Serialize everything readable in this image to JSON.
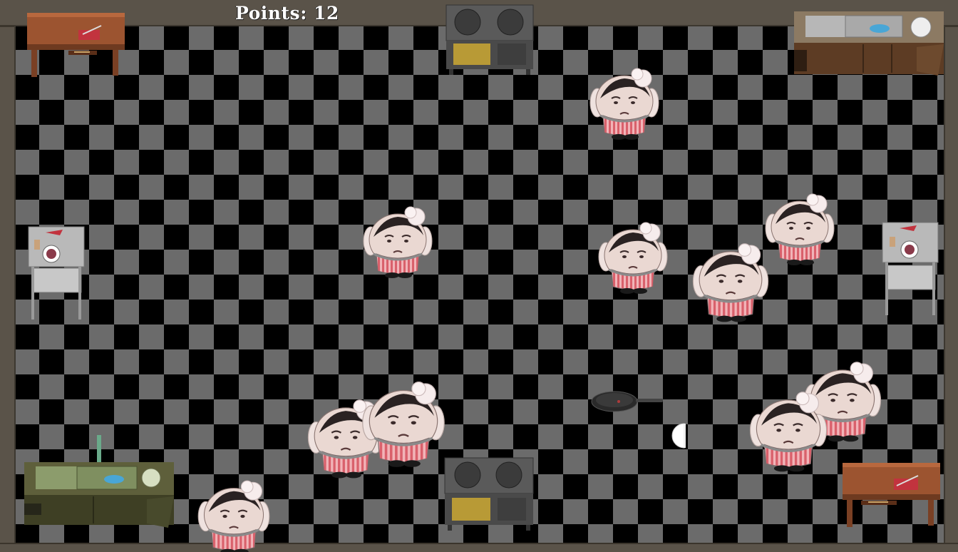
{
  "hud": {
    "points_label": "Points: 12"
  },
  "icons": {
    "chef": "chef-icon",
    "desk": "wooden-table-icon",
    "sink": "sink-counter-icon",
    "stove": "stove-icon",
    "prep_table": "prep-table-icon",
    "frying_pan": "frying-pan-icon",
    "player": "player-pacman-icon"
  },
  "colors": {
    "floor_dark": "#000000",
    "floor_light": "#6b6b6b",
    "wall": "#5a5349",
    "apron_stripe": "#e0707a",
    "hat": "#f4e6e6"
  }
}
